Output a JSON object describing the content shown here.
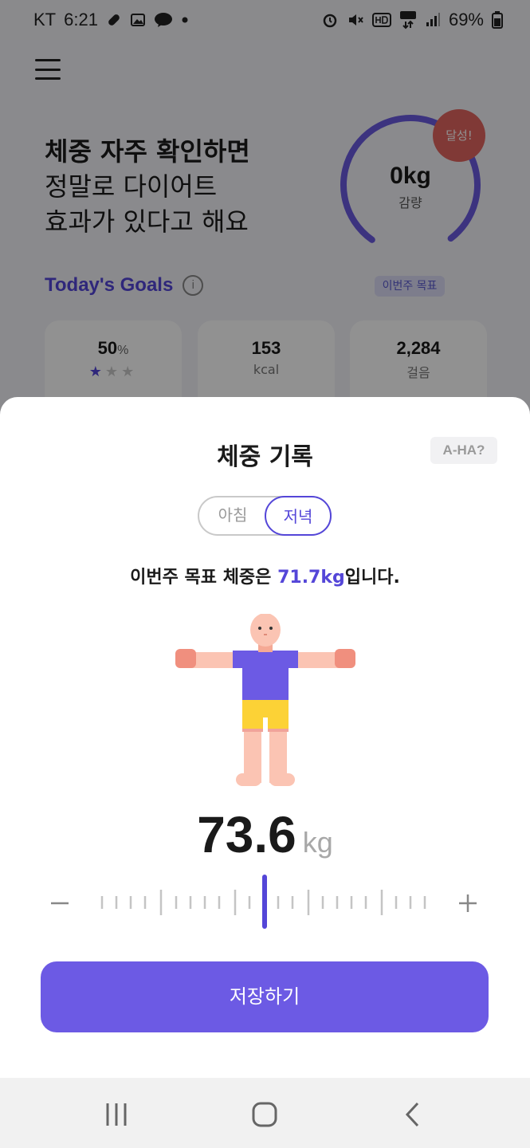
{
  "status_bar": {
    "carrier": "KT",
    "time": "6:21",
    "battery": "69%"
  },
  "background": {
    "headline_line1": "체중 자주 확인하면",
    "headline_line2": "정말로 다이어트",
    "headline_line3": "효과가 있다고 해요",
    "ring_value": "0kg",
    "ring_sub": "감량",
    "ring_pill": "이번주 목표",
    "achieve_badge": "달성!",
    "goals_title": "Today's Goals",
    "info_icon": "i",
    "cards": [
      {
        "value": "50",
        "unit": "%",
        "stars": 1
      },
      {
        "value": "153",
        "unit": "kcal"
      },
      {
        "value": "2,284",
        "unit": "걸음"
      }
    ]
  },
  "sheet": {
    "title": "체중 기록",
    "aha": "A-HA?",
    "toggle": {
      "morning": "아침",
      "evening": "저녁",
      "selected": "evening"
    },
    "goal_prefix": "이번주 목표 체중은 ",
    "goal_value": "71.7kg",
    "goal_suffix": "입니다.",
    "weight_value": "73.6",
    "weight_unit": "kg",
    "save_label": "저장하기"
  },
  "colors": {
    "accent": "#5446d8",
    "button": "#6c5ae4",
    "badge": "#e2645f"
  },
  "icons": {
    "menu": "hamburger-menu-icon",
    "minus": "minus-icon",
    "plus": "plus-icon",
    "nav_recent": "recent-apps-icon",
    "nav_home": "home-icon",
    "nav_back": "back-icon"
  }
}
